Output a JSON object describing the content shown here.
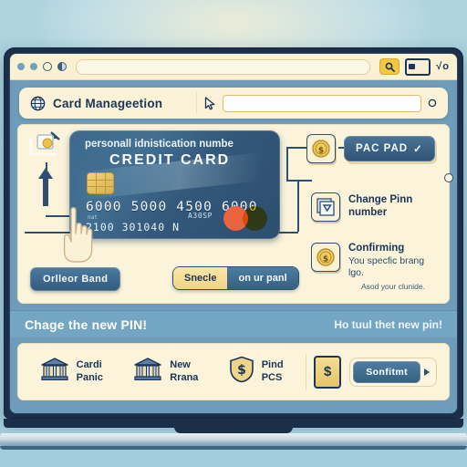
{
  "browser": {
    "traffic_dots": [
      "dot-1",
      "dot-2",
      "dot-3",
      "dot-4"
    ],
    "address_value": "",
    "actions": {
      "search_icon": "search-icon",
      "card_icon": "card-icon",
      "extra_glyph": "√o"
    }
  },
  "header": {
    "globe_icon": "globe-icon",
    "title": "Card  Manageetion",
    "cursor_icon": "pointer-arrow-icon",
    "search_value": "",
    "search_placeholder": "",
    "search_icon": "search-icon"
  },
  "panel": {
    "tray_icon": "card-tray-icon",
    "up_arrow_icon": "up-arrow-icon",
    "card": {
      "subtitle": "personall idnistication numbe",
      "type": "CREDIT  CARD",
      "chip_icon": "emv-chip-icon",
      "number": "6000 5000 4500 6000",
      "tiny_label": "nat",
      "tiny_label2": "A30SP",
      "holder": "2100  301040 N",
      "network_icon": "mastercard-logo"
    },
    "hand_cursor_icon": "hand-pointer-icon",
    "rows": [
      {
        "icon": "coin-dollar-icon",
        "button_label": "PAC PAD",
        "button_check": "✓"
      },
      {
        "icon": "change-frames-icon",
        "title": "Change Pinn",
        "subtitle": "number"
      },
      {
        "icon": "coin-dollar-icon",
        "title": "Confirming",
        "line1": "You specfic brang",
        "line2": "lgo.",
        "note": "Asod your clunide."
      }
    ],
    "band_button": "Orlleor  Band",
    "segment": {
      "left": "Snecle",
      "right": "on ur panl"
    }
  },
  "strip": {
    "left": "Chage the new PIN!",
    "right": "Ho tuul thet new pin!"
  },
  "footer": {
    "items": [
      {
        "icon": "bank-icon",
        "line1": "Cardi",
        "line2": "Panic"
      },
      {
        "icon": "bank-icon",
        "line1": "New",
        "line2": "Rrana"
      },
      {
        "icon": "shield-dollar-icon",
        "line1": "Pind",
        "line2": "PCS"
      }
    ],
    "gold_box_icon": "$",
    "confirm_label": "Sonfitmt",
    "confirm_caret": "caret-right-icon"
  },
  "colors": {
    "page_bg": "#a6cfdb",
    "cream": "#fbf3da",
    "navy": "#1b3558",
    "blue_strip": "#74a5c2",
    "card_blue": "#3d6a8c",
    "gold": "#f0d488"
  }
}
